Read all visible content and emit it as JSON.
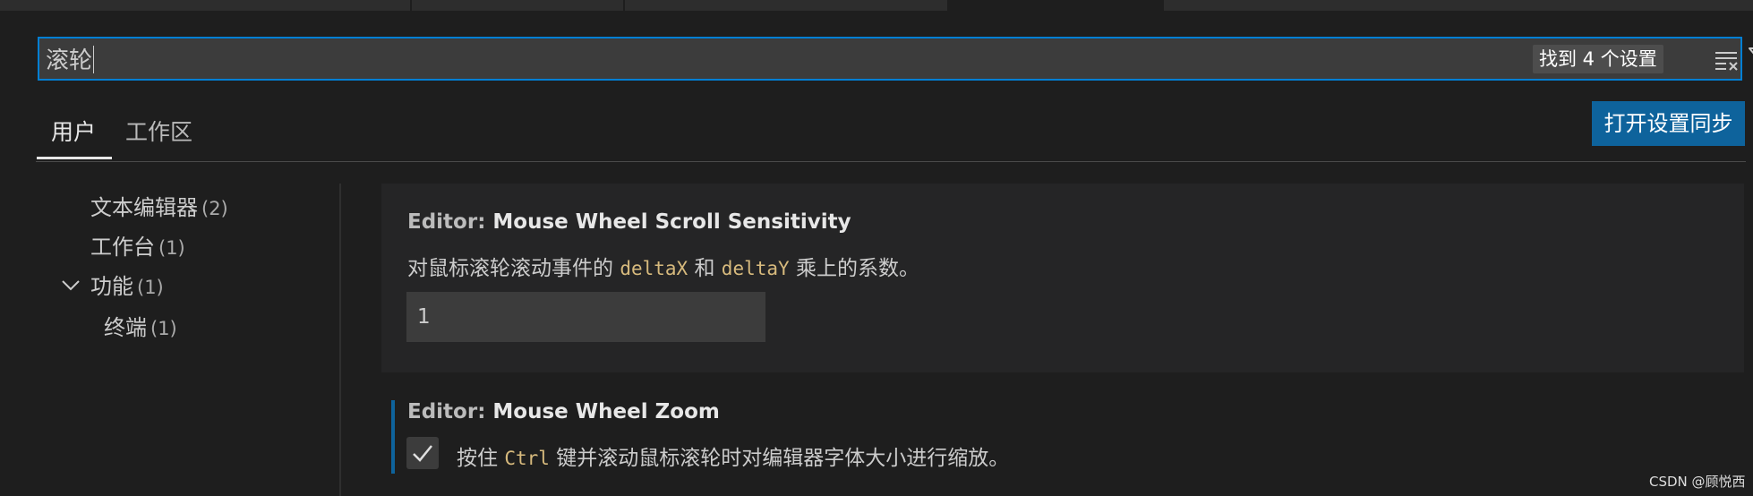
{
  "search": {
    "value": "滚轮",
    "result_count": "找到 4 个设置"
  },
  "tabs": {
    "user": "用户",
    "workspace": "工作区"
  },
  "sync_button": "打开设置同步",
  "toc": [
    {
      "label": "文本编辑器",
      "count": "(2)"
    },
    {
      "label": "工作台",
      "count": "(1)"
    },
    {
      "label": "功能",
      "count": "(1)"
    },
    {
      "label": "终端",
      "count": "(1)"
    }
  ],
  "settings": [
    {
      "category": "Editor:",
      "name": "Mouse Wheel Scroll Sensitivity",
      "desc_before": "对鼠标滚轮滚动事件的",
      "code1": "deltaX",
      "desc_mid": "和",
      "code2": "deltaY",
      "desc_after": "乘上的系数。",
      "value": "1"
    },
    {
      "category": "Editor:",
      "name": "Mouse Wheel Zoom",
      "desc_before": "按住",
      "code1": "Ctrl",
      "desc_after": "键并滚动鼠标滚轮时对编辑器字体大小进行缩放。",
      "checked": true
    }
  ],
  "watermark": "CSDN @顾悦西",
  "colors": {
    "accent": "#007fd4",
    "button": "#0e639c",
    "code": "#d7ba7d"
  },
  "icons": [
    "clear-filter-icon",
    "filter-icon",
    "chevron-down-icon",
    "checkmark-icon"
  ]
}
